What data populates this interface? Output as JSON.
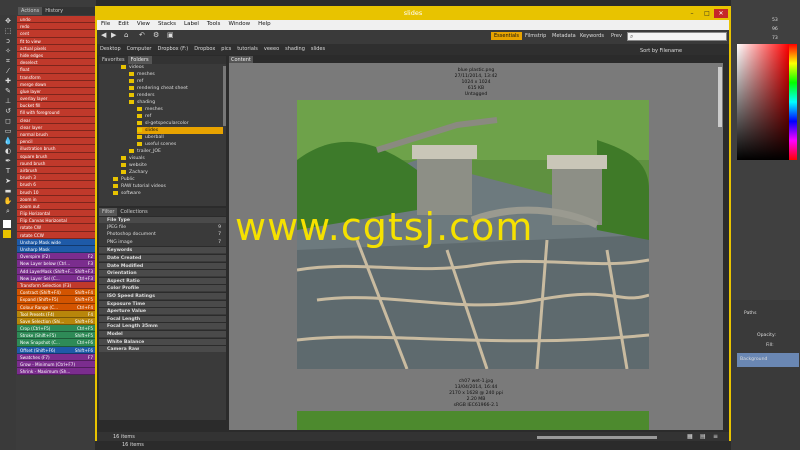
{
  "photoshop": {
    "tab_actions": "Actions",
    "tab_history": "History",
    "actions": [
      {
        "label": "undo",
        "color": "#c0392b",
        "key": ""
      },
      {
        "label": "redo",
        "color": "#c0392b",
        "key": ""
      },
      {
        "label": "cent",
        "color": "#c0392b",
        "key": ""
      },
      {
        "label": "fit to view",
        "color": "#c0392b",
        "key": ""
      },
      {
        "label": "actual pixels",
        "color": "#c0392b",
        "key": ""
      },
      {
        "label": "hide edges",
        "color": "#c0392b",
        "key": ""
      },
      {
        "label": "deselect",
        "color": "#c0392b",
        "key": ""
      },
      {
        "label": "float",
        "color": "#c0392b",
        "key": ""
      },
      {
        "label": "transform",
        "color": "#c0392b",
        "key": ""
      },
      {
        "label": "merge down",
        "color": "#c0392b",
        "key": ""
      },
      {
        "label": "glue layer",
        "color": "#c0392b",
        "key": ""
      },
      {
        "label": "overlay layer",
        "color": "#c0392b",
        "key": ""
      },
      {
        "label": "bucket fill",
        "color": "#c0392b",
        "key": ""
      },
      {
        "label": "fill with foreground",
        "color": "#c0392b",
        "key": ""
      },
      {
        "label": "clear",
        "color": "#c0392b",
        "key": ""
      },
      {
        "label": "clear layer",
        "color": "#c0392b",
        "key": ""
      },
      {
        "label": "normal brush",
        "color": "#c0392b",
        "key": ""
      },
      {
        "label": "pencil",
        "color": "#c0392b",
        "key": ""
      },
      {
        "label": "illustration brush",
        "color": "#c0392b",
        "key": ""
      },
      {
        "label": "square brush",
        "color": "#c0392b",
        "key": ""
      },
      {
        "label": "round brush",
        "color": "#c0392b",
        "key": ""
      },
      {
        "label": "airbrush",
        "color": "#c0392b",
        "key": ""
      },
      {
        "label": "brush 3",
        "color": "#c0392b",
        "key": ""
      },
      {
        "label": "brush 6",
        "color": "#c0392b",
        "key": ""
      },
      {
        "label": "brush 10",
        "color": "#c0392b",
        "key": ""
      },
      {
        "label": "zoom in",
        "color": "#c0392b",
        "key": ""
      },
      {
        "label": "zoom out",
        "color": "#c0392b",
        "key": ""
      },
      {
        "label": "Flip Horizontal",
        "color": "#c0392b",
        "key": ""
      },
      {
        "label": "Flip Canvas Horizontal",
        "color": "#c0392b",
        "key": ""
      },
      {
        "label": "rotate CW",
        "color": "#c0392b",
        "key": ""
      },
      {
        "label": "rotate CCW",
        "color": "#c0392b",
        "key": ""
      },
      {
        "label": "Unsharp Mask wide",
        "color": "#1e5aa8",
        "key": ""
      },
      {
        "label": "Unsharp Mask",
        "color": "#1e5aa8",
        "key": ""
      },
      {
        "label": "Overspire (F2)",
        "color": "#7b2d8e",
        "key": "F2"
      },
      {
        "label": "New Layer below (Ctrl...",
        "color": "#7b2d8e",
        "key": "F3"
      },
      {
        "label": "Add LayerMask (Shift+F...",
        "color": "#7b2d8e",
        "key": "Shift+F3"
      },
      {
        "label": "New Layer Sel (C...",
        "color": "#7b2d8e",
        "key": "Ctrl+F3"
      },
      {
        "label": "Transform Selection (F3)",
        "color": "#c0392b",
        "key": ""
      },
      {
        "label": "Contract (Shift+F4)",
        "color": "#d35400",
        "key": "Shift+F4"
      },
      {
        "label": "Expand (Shift+F5)",
        "color": "#d35400",
        "key": "Shift+F5"
      },
      {
        "label": "Colour Range (C...",
        "color": "#d35400",
        "key": "Ctrl+F4"
      },
      {
        "label": "Tool Presets (F4)",
        "color": "#b8860b",
        "key": "F4"
      },
      {
        "label": "Save Selection (Shi...",
        "color": "#b8860b",
        "key": "Shift+F6"
      },
      {
        "label": "Crop (Ctrl+F5)",
        "color": "#2e8b57",
        "key": "Ctrl+F5"
      },
      {
        "label": "Stroke (Shift+F5)",
        "color": "#2e8b57",
        "key": "Shift+F5"
      },
      {
        "label": "New Snapshot (C...",
        "color": "#2e8b57",
        "key": "Ctrl+F6"
      },
      {
        "label": "Offset (Shift+F6)",
        "color": "#1e5aa8",
        "key": "Shift+F6"
      },
      {
        "label": "Swatches (F7)",
        "color": "#7b2d8e",
        "key": "F7"
      },
      {
        "label": "Grow - Minimum (Ctrl+F7)",
        "color": "#7b2d8e",
        "key": ""
      },
      {
        "label": "Shrink - Maximum (Sh...",
        "color": "#7b2d8e",
        "key": ""
      }
    ],
    "right_numbers": [
      "53",
      "96",
      "73"
    ],
    "paths_label": "Paths",
    "opacity_label": "Opacity:",
    "fill_label": "Fill:",
    "layer_name": "Background"
  },
  "bridge": {
    "title": "slides",
    "menu": [
      "File",
      "Edit",
      "View",
      "Stacks",
      "Label",
      "Tools",
      "Window",
      "Help"
    ],
    "workspaces": [
      "Essentials",
      "Filmstrip",
      "Metadata",
      "Keywords",
      "Prev"
    ],
    "path": [
      "Desktop",
      "Computer",
      "Dropbox (F:)",
      "Dropbox",
      "pics",
      "tutorials",
      "veeeo",
      "shading",
      "slides"
    ],
    "sort_label": "Sort by Filename",
    "tab_favorites": "Favorites",
    "tab_folders": "Folders",
    "folders": [
      {
        "label": "videos",
        "indent": 2
      },
      {
        "label": "meshes",
        "indent": 3
      },
      {
        "label": "ref",
        "indent": 3
      },
      {
        "label": "rendering cheat sheet",
        "indent": 3
      },
      {
        "label": "renders",
        "indent": 3
      },
      {
        "label": "shading",
        "indent": 3
      },
      {
        "label": "meshes",
        "indent": 4
      },
      {
        "label": "ref",
        "indent": 4
      },
      {
        "label": "sl-getspecularcolor",
        "indent": 4
      },
      {
        "label": "slides",
        "indent": 4,
        "selected": true
      },
      {
        "label": "uberball",
        "indent": 4
      },
      {
        "label": "useful scenes",
        "indent": 4
      },
      {
        "label": "trailer_JOE",
        "indent": 3
      },
      {
        "label": "visuals",
        "indent": 2
      },
      {
        "label": "website",
        "indent": 2
      },
      {
        "label": "Zachary",
        "indent": 2
      },
      {
        "label": "Public",
        "indent": 1
      },
      {
        "label": "RAW tutorial videos",
        "indent": 1
      },
      {
        "label": "software",
        "indent": 1
      }
    ],
    "tab_filter": "Filter",
    "tab_collections": "Collections",
    "filters": [
      {
        "label": "File Type",
        "count": "",
        "header": true
      },
      {
        "label": "JPEG file",
        "count": "9",
        "header": false
      },
      {
        "label": "Photoshop document",
        "count": "7",
        "header": false
      },
      {
        "label": "PNG image",
        "count": "7",
        "header": false
      },
      {
        "label": "Keywords",
        "count": "",
        "header": true
      },
      {
        "label": "Date Created",
        "count": "",
        "header": true
      },
      {
        "label": "Date Modified",
        "count": "",
        "header": true
      },
      {
        "label": "Orientation",
        "count": "",
        "header": true
      },
      {
        "label": "Aspect Ratio",
        "count": "",
        "header": true
      },
      {
        "label": "Color Profile",
        "count": "",
        "header": true
      },
      {
        "label": "ISO Speed Ratings",
        "count": "",
        "header": true
      },
      {
        "label": "Exposure Time",
        "count": "",
        "header": true
      },
      {
        "label": "Aperture Value",
        "count": "",
        "header": true
      },
      {
        "label": "Focal Length",
        "count": "",
        "header": true
      },
      {
        "label": "Focal Length 35mm",
        "count": "",
        "header": true
      },
      {
        "label": "Model",
        "count": "",
        "header": true
      },
      {
        "label": "White Balance",
        "count": "",
        "header": true
      },
      {
        "label": "Camera Raw",
        "count": "",
        "header": true
      }
    ],
    "tab_content": "Content",
    "item1": {
      "name": "blue plastic.png",
      "date": "27/11/2014, 13:42",
      "size": "1024 x 1024",
      "file_size": "615 KB",
      "label": "Untagged"
    },
    "item2": {
      "name": "ch07 wet-1.jpg",
      "date": "13/04/2014, 16:44",
      "size": "2170 x 1628 @ 240 ppi",
      "file_size": "2.20 MB",
      "profile": "sRGB IEC61966-2.1"
    },
    "status_items": "16 items",
    "watermark": "www.cgtsj.com"
  }
}
